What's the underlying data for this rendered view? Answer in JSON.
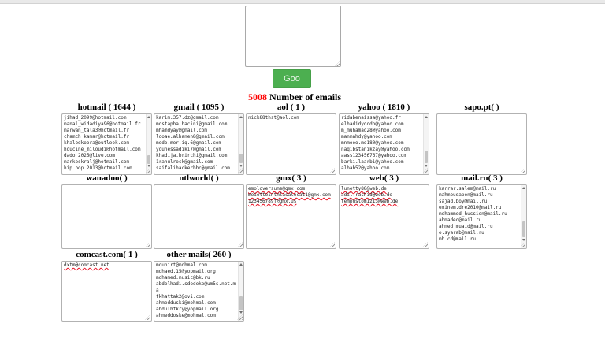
{
  "input": {
    "value": "",
    "placeholder": ""
  },
  "actions": {
    "go_label": "Goo"
  },
  "count": {
    "value": "5008",
    "label": "Number of emails",
    "value_color": "#ff0000"
  },
  "colors": {
    "accent_green": "#4caf50",
    "spellcheck_red": "#e81123"
  },
  "boxes": [
    {
      "title": "hotmail ( 1644 )",
      "emails": [
        "jihad_2099@hotmail.com",
        "manal_widadiya96@hotmail.fr",
        "marwan_tala3@hotmail.fr",
        "chamch_kamar@hotmail.fr",
        "khaledkoora@outlook.com",
        "houcine_miloudi@hotmail.com",
        "dado_2025@live.com",
        "markoskralj@hotmail.com",
        "hip.hop.2013@hotmail.com"
      ]
    },
    {
      "title": "gmail ( 1095 )",
      "emails": [
        "karim.357.dz@gmail.com",
        "mostapha.hacini@gmail.com",
        "mhamdyay@gmail.com",
        "looae.alhanen8@gmail.com",
        "medo.mor.iq.6@gmail.com",
        "younessadiki7@gmail.com",
        "khadija.brirchi@gmail.com",
        "1rahulrock@gmail.com",
        "saifalihackerbbc@gmail.com"
      ]
    },
    {
      "title": "aol ( 1 )",
      "emails": [
        "nick88thst@aol.com"
      ]
    },
    {
      "title": "yahoo ( 1810 )",
      "emails": [
        "ridabenaissa@yahoo.fr",
        "elhadidydodo@yahoo.com",
        "m_muhamad28@yahoo.com",
        "manmahdy@yahoo.com",
        "mnmooo.mo180@yahoo.com",
        "naqibstanikzay@yahoo.com",
        "aass123456767@yahoo.com",
        "barki.laarbi@yahoo.com",
        "albab52@yahoo.com"
      ]
    },
    {
      "title": "sapo.pt( )",
      "emails": []
    },
    {
      "title": "wanadoo( )",
      "emails": []
    },
    {
      "title": "ntlworld( )",
      "emails": []
    },
    {
      "title": "gmx( 3 )",
      "emails": [
        "emoloversums@gmx.com",
        "moiettointmlasalecat1@gmx.com",
        "123456789f@gmx.us"
      ]
    },
    {
      "title": "web( 3 )",
      "emails": [
        "lunetty88@web.de",
        "adil.rashid@web.de",
        "tempustom1213@web.de"
      ]
    },
    {
      "title": "mail.ru( 3 )",
      "emails": [
        "karrar.salem@mail.ru",
        "mahmoudapen@mail.ru",
        "sajad.boy@mail.ru",
        "eminem.dre2010@mail.ru",
        "mohammed_hussien@mail.ru",
        "ahmadeo@mail.ru",
        "ahmed_muaid@mail.ru",
        "o.syarab@mail.ru",
        "mh.cd@mail.ru"
      ]
    },
    {
      "title": "comcast.com( 1 )",
      "emails": [
        "dxtm@comcast.net"
      ]
    },
    {
      "title": "other mails( 260 )",
      "emails": [
        "mounirt@mohmal.com",
        "mohaed.15@yopmail.org",
        "mohamed.music@bk.ru",
        "abdelhadi.sdedeke@um5s.net.ma",
        "fkhattak2@ovi.com",
        "ahmedduski@mohmal.com",
        "abdulhfkry@yopmail.org",
        "ahmeddoske@mohmal.com"
      ]
    }
  ]
}
